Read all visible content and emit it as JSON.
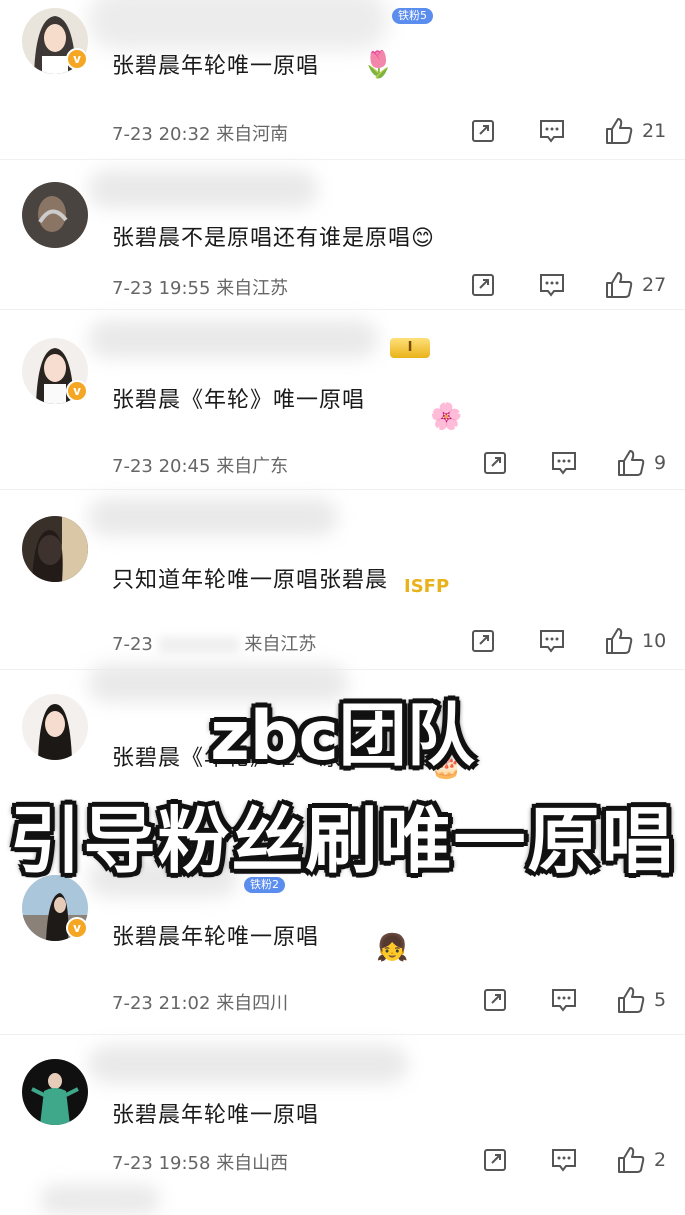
{
  "comments": [
    {
      "text": "张碧晨年轮唯一原唱",
      "time": "7-23 20:32",
      "location": "来自河南",
      "likes": "21",
      "badge": "铁粉5",
      "verified": true,
      "deco": "tulip"
    },
    {
      "text": "张碧晨不是原唱还有谁是原唱😊",
      "time": "7-23 19:55",
      "location": "来自江苏",
      "likes": "27",
      "badge": "",
      "verified": false,
      "deco": ""
    },
    {
      "text": "张碧晨《年轮》唯一原唱",
      "time": "7-23 20:45",
      "location": "来自广东",
      "likes": "9",
      "badge": "I",
      "verified": true,
      "deco": "flower"
    },
    {
      "text": "只知道年轮唯一原唱张碧晨",
      "time": "7-23",
      "location": "来自江苏",
      "likes": "10",
      "badge": "",
      "verified": false,
      "deco": "isfp"
    },
    {
      "text": "张碧晨《年轮》唯一原唱",
      "time": "",
      "location": "",
      "likes": "",
      "badge": "",
      "verified": false,
      "deco": "cake"
    },
    {
      "text": "张碧晨年轮唯一原唱",
      "time": "7-23 21:02",
      "location": "来自四川",
      "likes": "5",
      "badge": "铁粉2",
      "verified": true,
      "deco": "maruko"
    },
    {
      "text": "张碧晨年轮唯一原唱",
      "time": "7-23 19:58",
      "location": "来自山西",
      "likes": "2",
      "badge": "",
      "verified": false,
      "deco": ""
    }
  ],
  "overlay": {
    "line1": "zbc团队",
    "line2": "引导粉丝刷唯一原唱"
  },
  "icons": {
    "share": "share-icon",
    "comment": "comment-icon",
    "like": "thumbs-up-icon"
  },
  "colors": {
    "accent": "#f5a623",
    "text": "#1a1a1a",
    "meta": "#666666"
  }
}
